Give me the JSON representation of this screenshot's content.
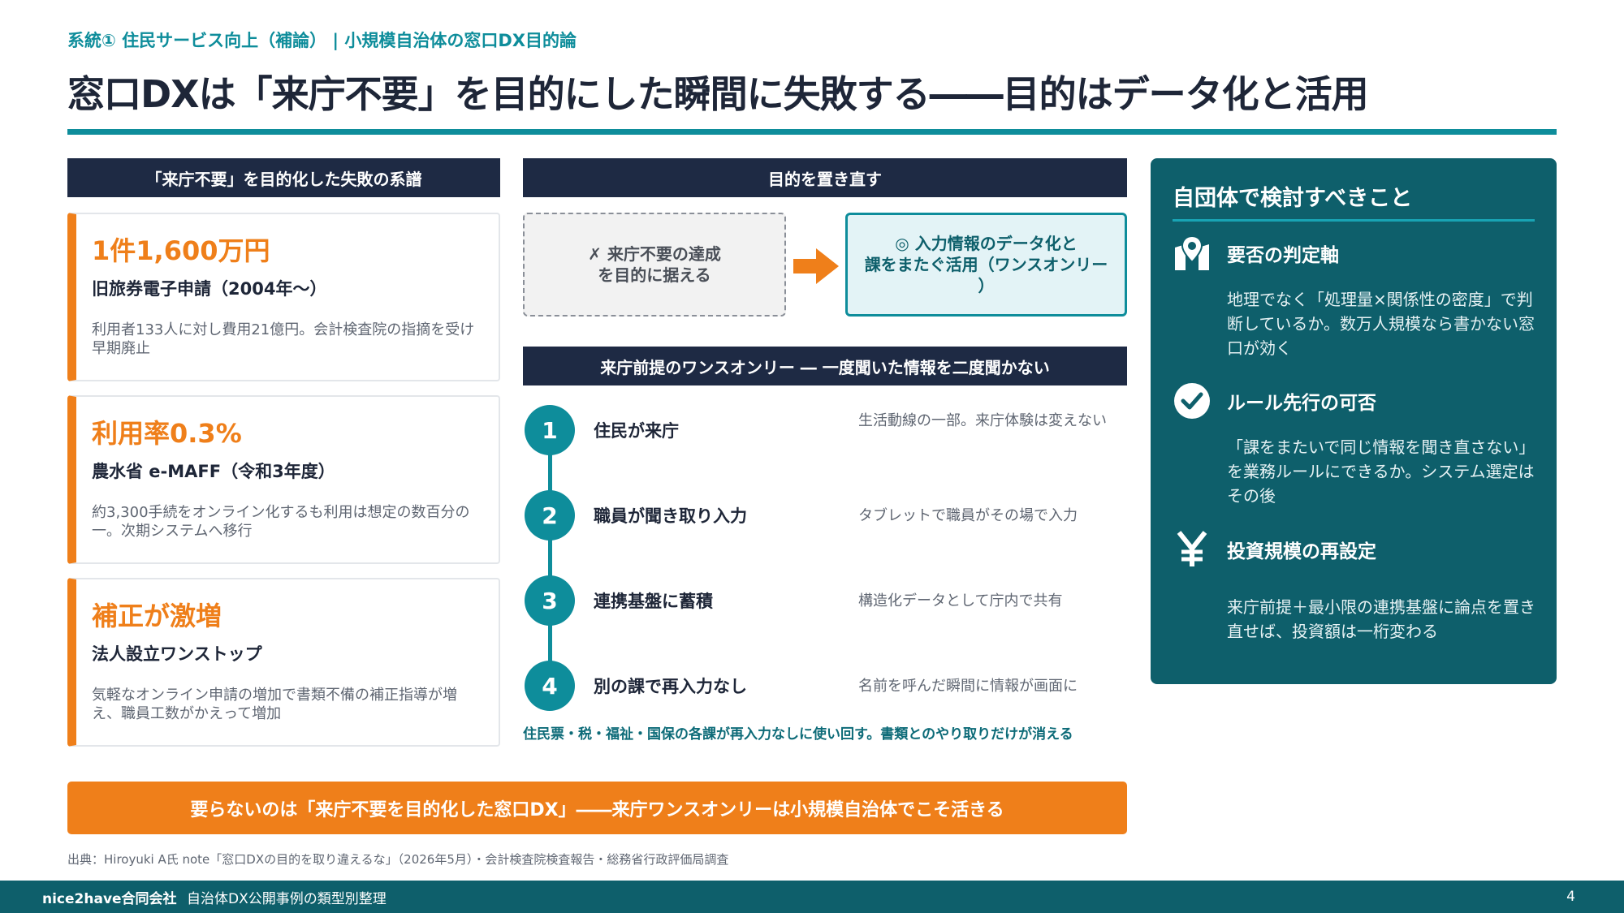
{
  "header": {
    "eyebrow": "系統① 住民サービス向上（補論） | 小規模自治体の窓口DX目的論",
    "title": "窓口DXは「来庁不要」を目的にした瞬間に失敗する――目的はデータ化と活用"
  },
  "left_section": {
    "heading": "「来庁不要」を目的化した失敗の系譜",
    "cards": [
      {
        "big": "1件1,600万円",
        "name": "旧旅券電子申請（2004年〜）",
        "desc": "利用者133人に対し費用21億円。会計検査院の指摘を受け早期廃止"
      },
      {
        "big": "利用率0.3%",
        "name": "農水省 e-MAFF（令和3年度）",
        "desc": "約3,300手続をオンライン化するも利用は想定の数百分の一。次期システムへ移行"
      },
      {
        "big": "補正が激増",
        "name": "法人設立ワンストップ",
        "desc": "気軽なオンライン申請の増加で書類不備の補正指導が増え、職員工数がかえって増加"
      }
    ]
  },
  "reframe": {
    "heading": "目的を置き直す",
    "old_line1": "✗ 来庁不要の達成",
    "old_line2": "を目的に据える",
    "new_line1": "◎ 入力情報のデータ化と",
    "new_line2": "課をまたぐ活用（ワンスオンリー",
    "new_line3": "）"
  },
  "once_only": {
    "heading": "来庁前提のワンスオンリー ― 一度聞いた情報を二度聞かない",
    "steps": [
      {
        "num": "1",
        "title": "住民が来庁",
        "desc": "生活動線の一部。来庁体験は変えない"
      },
      {
        "num": "2",
        "title": "職員が聞き取り入力",
        "desc": "タブレットで職員がその場で入力"
      },
      {
        "num": "3",
        "title": "連携基盤に蓄積",
        "desc": "構造化データとして庁内で共有"
      },
      {
        "num": "4",
        "title": "別の課で再入力なし",
        "desc": "名前を呼んだ瞬間に情報が画面に"
      }
    ],
    "note": "住民票・税・福祉・国保の各課が再入力なしに使い回す。書類とのやり取りだけが消える"
  },
  "right_panel": {
    "title": "自団体で検討すべきこと",
    "items": [
      {
        "icon": "map-pin-icon",
        "title": "要否の判定軸",
        "desc": "地理でなく「処理量×関係性の密度」で判断しているか。数万人規模なら書かない窓口が効く"
      },
      {
        "icon": "check-circle-icon",
        "title": "ルール先行の可否",
        "desc": "「課をまたいで同じ情報を聞き直さない」を業務ルールにできるか。システム選定はその後"
      },
      {
        "icon": "yen-icon",
        "title": "投資規模の再設定",
        "desc": "来庁前提＋最小限の連携基盤に論点を置き直せば、投資額は一桁変わる"
      }
    ]
  },
  "conclusion": "要らないのは「来庁不要を目的化した窓口DX」――来庁ワンスオンリーは小規模自治体でこそ活きる",
  "source": "出典：Hiroyuki A氏 note「窓口DXの目的を取り違えるな」（2026年5月）・会計検査院検査報告・総務省行政評価局調査",
  "footer": {
    "company": "nice2have合同会社",
    "doc": "自治体DX公開事例の類型別整理",
    "page": "4"
  },
  "colors": {
    "accent_teal": "#0e8d9b",
    "accent_orange": "#ef7f1a",
    "navy": "#1e2a44",
    "panel_teal": "#0e5f6b"
  }
}
